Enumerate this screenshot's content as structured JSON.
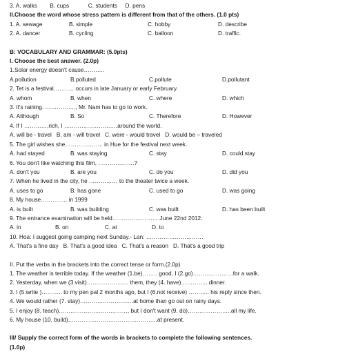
{
  "document": {
    "pre_lines": [
      {
        "id": "q3-phonetics-options",
        "text": "3. A. walks        B. cups            C. students     D. pens"
      }
    ],
    "section_stress": {
      "heading": "II.Choose the word whose stress pattern is different from that of the others. (1.0 pts)",
      "questions": [
        {
          "number": "1.",
          "options": [
            "1. A. sewage",
            "B. simple",
            "C. hobby",
            "D. describe"
          ]
        },
        {
          "number": "2.",
          "options": [
            "2. A. dancer",
            "B. cycling",
            "C. balloon",
            "D. traffic."
          ]
        }
      ]
    },
    "section_b": {
      "heading": "B: VOCABULARY AND GRAMMAR: (5.0pts)",
      "part_i": {
        "heading": "I. Choose the best answer. (2.0p)",
        "questions": [
          {
            "stem": "1.Solar energy doesn't cause………..",
            "options": [
              "A.pollution",
              "B.polluted",
              "C.pollute",
              "D.pollutant"
            ],
            "style": "c4"
          },
          {
            "stem": "2. Tet is a festival……….. occurs in late January or early February.",
            "options": [
              "A. whom",
              "B. when",
              "C. where",
              "D. which"
            ],
            "style": "c4"
          },
          {
            "stem": "3. It's raining. ……………., Mr. Nam has to go to work.",
            "options": [
              "A. Although",
              "B. So",
              "C. Therefore",
              "D. However"
            ],
            "style": "c4"
          },
          {
            "stem": "4. If I ………….rich, I ……………………….around the world.",
            "options": [
              "A. will be - travel",
              "B. am - will travel",
              "C. were - would travel",
              "D. would be – traveled"
            ],
            "style": "cw"
          },
          {
            "stem": "5. The girl wishes she……………….. in Hue for the festival next week.",
            "options": [
              "A. had stayed",
              "B. was staying",
              "C. stay",
              "D. could stay"
            ],
            "style": "c4"
          },
          {
            "stem": "6. You don't like watching this film, ……………….?",
            "options": [
              "A. don't you",
              "B. are you",
              "C. do you",
              "D. did you"
            ],
            "style": "c4"
          },
          {
            "stem": "7. When he lived in the city, he …………… to the theater twice a week.",
            "options": [
              "A. uses to go",
              "B. has gone",
              "C. used to go",
              "D. was going"
            ],
            "style": "c4"
          },
          {
            "stem": "8. My house………….. in 1999",
            "options": [
              "A. is built",
              "B. was building",
              "C. was built",
              "D. has been built"
            ],
            "style": "c4"
          },
          {
            "stem": "9. The entrance examination will be held…………………….June 22nd 2012.",
            "options": [
              "A. in",
              "B. on",
              "C. at",
              "D. to"
            ],
            "style": "cn"
          },
          {
            "stem": "10. Hoa: I suggest going camping next Sunday.- Lan: …………………………",
            "options": [
              "A. That's a fine day",
              "B. That's a good idea",
              "C. That's a reason",
              "D. That's a good trip"
            ],
            "style": "cw"
          }
        ]
      },
      "part_ii": {
        "heading": "II. Put the verbs in the brackets into the correct tense or form.(2.0p)",
        "items": [
          "1. The weather is terrible today. If the weather (1.be)…….. good, I (2.go)…………………for a walk.",
          "2. Yesterday, when we (3.visit)…………………. them, they (4. have)………….. dinner.",
          "3. I (5.write )……….. to my pen pal 2 months ago, but I (6.not receive) ……….. his reply since then.",
          "4. We would rather (7. stay)……………………….at home than go out on rainy days.",
          "5. I enjoy (8. teach)………………………………, but I don't want (9. do)…………………..all my life.",
          "6. My house (10. build)………………………………………..at present."
        ]
      },
      "part_iii": {
        "heading": "III/ Supply the correct form of the words in brackets to complete the following sentences.",
        "points": "(1.0p)"
      }
    }
  }
}
